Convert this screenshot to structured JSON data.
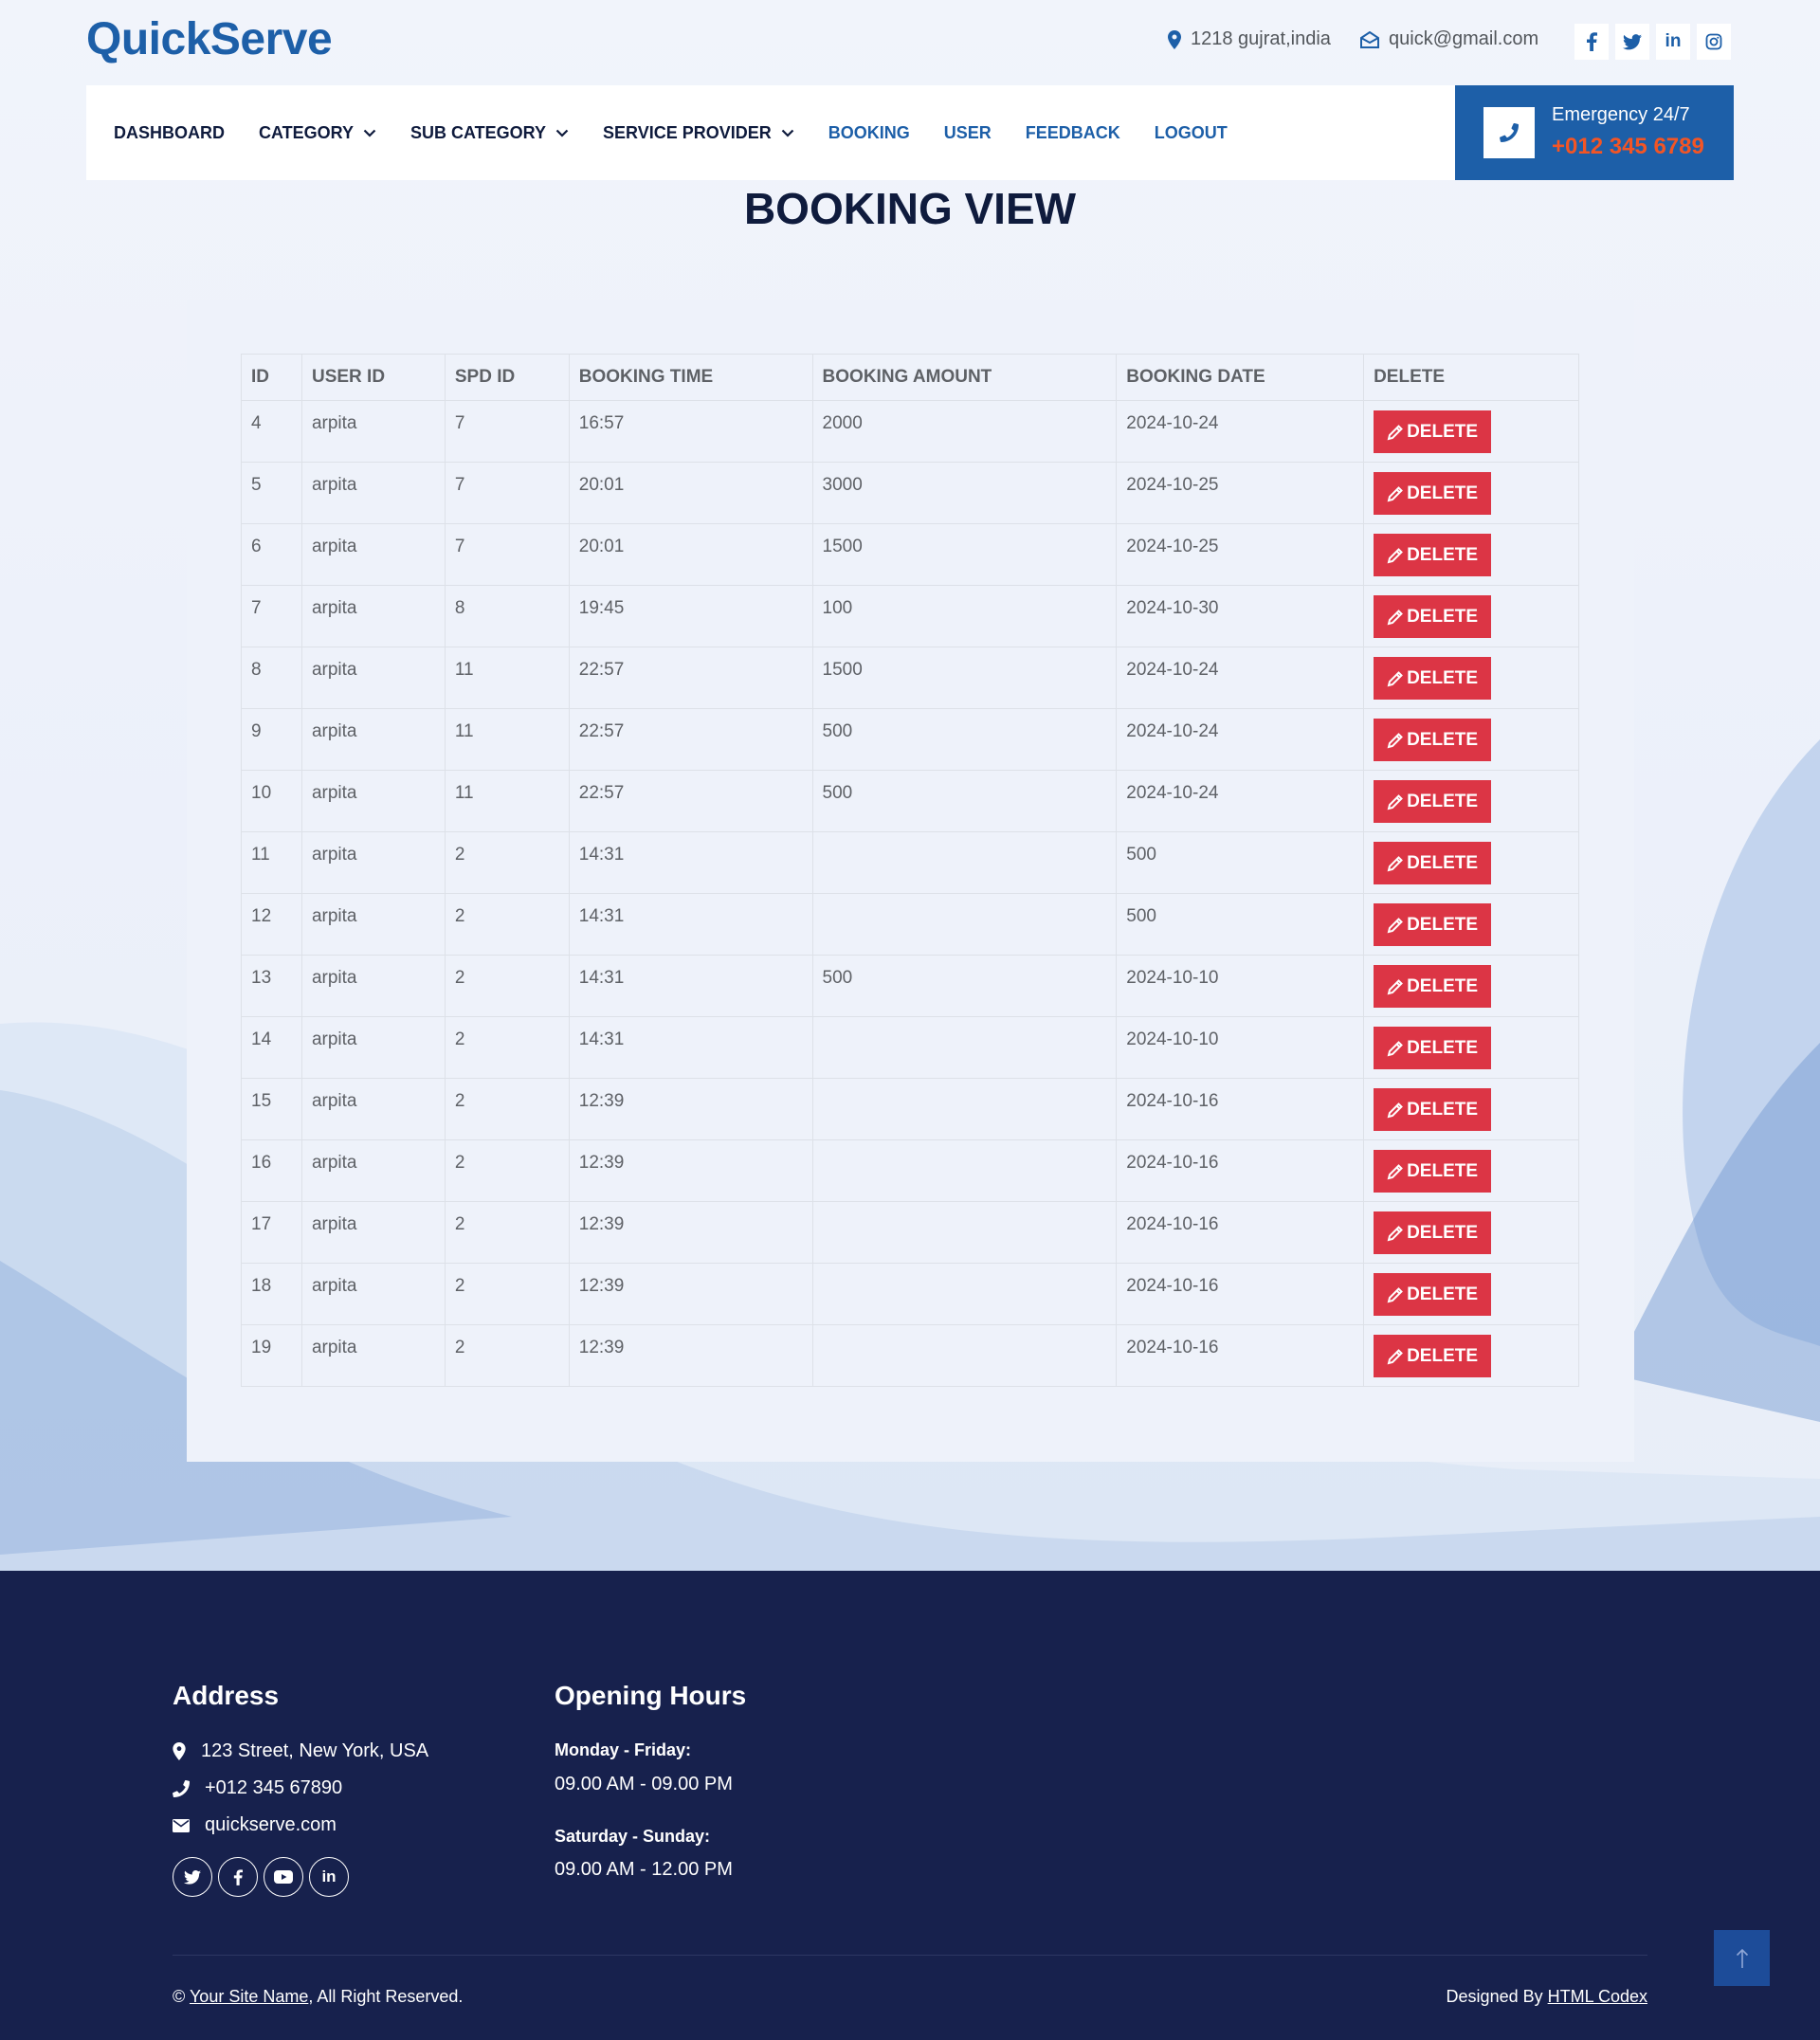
{
  "header": {
    "brand": "QuickServe",
    "address": "1218 gujrat,india",
    "email": "quick@gmail.com",
    "social": [
      {
        "icon": "facebook-icon",
        "glyph": "f"
      },
      {
        "icon": "twitter-icon",
        "glyph": "t"
      },
      {
        "icon": "linkedin-icon",
        "glyph": "in"
      },
      {
        "icon": "instagram-icon",
        "glyph": "ig"
      }
    ]
  },
  "nav": {
    "items": [
      {
        "label": "DASHBOARD",
        "dropdown": false
      },
      {
        "label": "CATEGORY",
        "dropdown": true
      },
      {
        "label": "SUB CATEGORY",
        "dropdown": true
      },
      {
        "label": "SERVICE PROVIDER",
        "dropdown": true
      },
      {
        "label": "BOOKING",
        "dropdown": false
      },
      {
        "label": "USER",
        "dropdown": false
      },
      {
        "label": "FEEDBACK",
        "dropdown": false
      },
      {
        "label": "LOGOUT",
        "dropdown": false
      }
    ],
    "emergency_label": "Emergency 24/7",
    "emergency_phone": "+012 345 6789"
  },
  "main": {
    "title": "BOOKING VIEW",
    "table": {
      "headers": [
        "ID",
        "USER ID",
        "SPD ID",
        "BOOKING TIME",
        "BOOKING AMOUNT",
        "BOOKING DATE",
        "DELETE"
      ],
      "delete_label": "DELETE",
      "rows": [
        [
          "4",
          "arpita",
          "7",
          "16:57",
          "2000",
          "2024-10-24"
        ],
        [
          "5",
          "arpita",
          "7",
          "20:01",
          "3000",
          "2024-10-25"
        ],
        [
          "6",
          "arpita",
          "7",
          "20:01",
          "1500",
          "2024-10-25"
        ],
        [
          "7",
          "arpita",
          "8",
          "19:45",
          "100",
          "2024-10-30"
        ],
        [
          "8",
          "arpita",
          "11",
          "22:57",
          "1500",
          "2024-10-24"
        ],
        [
          "9",
          "arpita",
          "11",
          "22:57",
          "500",
          "2024-10-24"
        ],
        [
          "10",
          "arpita",
          "11",
          "22:57",
          "500",
          "2024-10-24"
        ],
        [
          "11",
          "arpita",
          "2",
          "14:31",
          "",
          "500"
        ],
        [
          "12",
          "arpita",
          "2",
          "14:31",
          "",
          "500"
        ],
        [
          "13",
          "arpita",
          "2",
          "14:31",
          "500",
          "2024-10-10"
        ],
        [
          "14",
          "arpita",
          "2",
          "14:31",
          "",
          "2024-10-10"
        ],
        [
          "15",
          "arpita",
          "2",
          "12:39",
          "",
          "2024-10-16"
        ],
        [
          "16",
          "arpita",
          "2",
          "12:39",
          "",
          "2024-10-16"
        ],
        [
          "17",
          "arpita",
          "2",
          "12:39",
          "",
          "2024-10-16"
        ],
        [
          "18",
          "arpita",
          "2",
          "12:39",
          "",
          "2024-10-16"
        ],
        [
          "19",
          "arpita",
          "2",
          "12:39",
          "",
          "2024-10-16"
        ]
      ]
    }
  },
  "footer": {
    "address_title": "Address",
    "address": "123 Street, New York, USA",
    "phone": "+012 345 67890",
    "website": "quickserve.com",
    "hours_title": "Opening Hours",
    "weekday_label": "Monday - Friday:",
    "weekday_hours": "09.00 AM - 09.00 PM",
    "weekend_label": "Saturday - Sunday:",
    "weekend_hours": "09.00 AM - 12.00 PM",
    "copyright_symbol": "©",
    "site_name": "Your Site Name",
    "rights": ", All Right Reserved.",
    "designed_by": "Designed By",
    "designer": "HTML Codex"
  },
  "colors": {
    "brand": "#1d5fa8",
    "accent_orange": "#f35525",
    "danger": "#dc3545",
    "footer_bg": "#17214d"
  }
}
